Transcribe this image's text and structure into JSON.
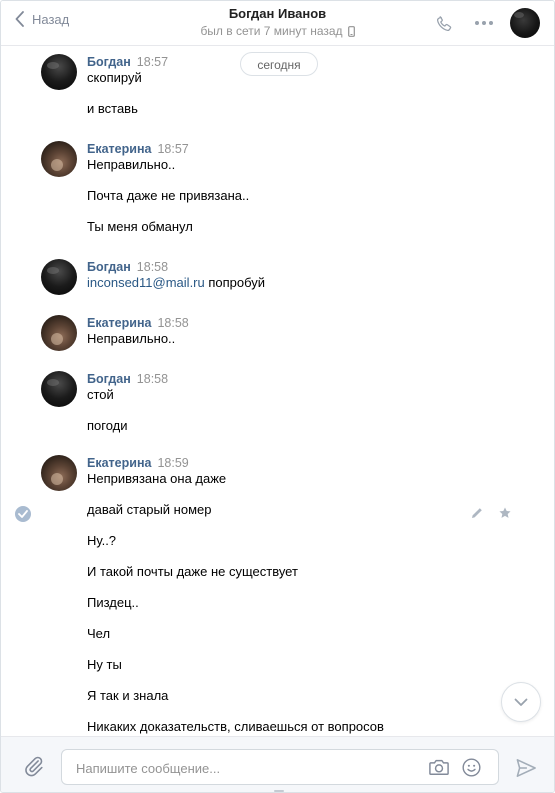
{
  "header": {
    "back_label": "Назад",
    "contact_name": "Богдан Иванов",
    "status": "был в сети 7 минут назад"
  },
  "chat": {
    "date_badge": "сегодня",
    "groups": [
      {
        "sender": "Богдан",
        "time": "18:57",
        "messages": [
          "скопируй",
          "и вставь"
        ]
      },
      {
        "sender": "Екатерина",
        "time": "18:57",
        "messages": [
          "Неправильно..",
          "Почта даже не привязана..",
          "Ты меня обманул"
        ]
      },
      {
        "sender": "Богдан",
        "time": "18:58",
        "link": "inconsed11@mail.ru",
        "messages": [
          "попробуй"
        ]
      },
      {
        "sender": "Екатерина",
        "time": "18:58",
        "messages": [
          "Неправильно.."
        ]
      },
      {
        "sender": "Богдан",
        "time": "18:58",
        "messages": [
          "стой",
          "погоди"
        ]
      },
      {
        "sender": "Екатерина",
        "time": "18:59",
        "messages": [
          "Непривязана она даже",
          "давай старый номер",
          "Ну..?",
          "И такой почты даже не существует",
          "Пиздец..",
          "Чел",
          "Ну ты",
          "Я так и знала",
          "Никаких доказательств, сливаешься от вопросов"
        ]
      }
    ]
  },
  "composer": {
    "placeholder": "Напишите сообщение..."
  },
  "colors": {
    "accent": "#42648b",
    "link": "#2a5885",
    "muted": "#939393",
    "composer_bg": "#f5f7fa"
  },
  "icons": [
    "chevron-left-icon",
    "phone-icon",
    "more-icon",
    "mobile-icon",
    "check-circle-icon",
    "edit-icon",
    "star-icon",
    "chevron-down-icon",
    "paperclip-icon",
    "camera-icon",
    "smile-icon",
    "send-icon"
  ]
}
